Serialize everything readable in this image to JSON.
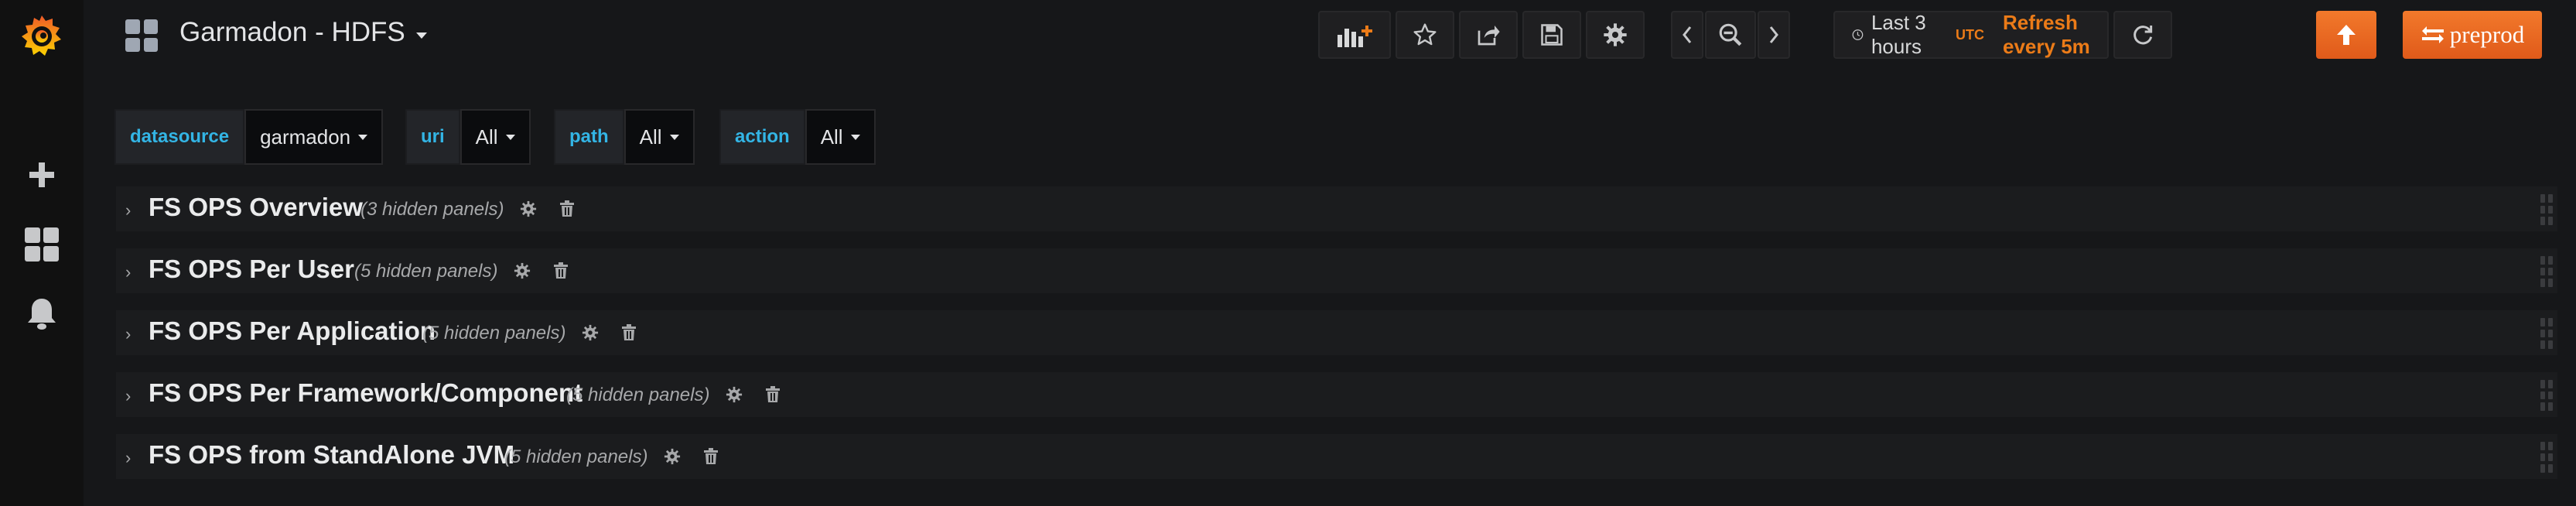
{
  "dashboard": {
    "title": "Garmadon - HDFS"
  },
  "toolbar": {
    "add_panel": "add-panel-icon",
    "star": "star-icon",
    "share": "share-icon",
    "save": "save-icon",
    "settings": "gear-icon",
    "time_back": "chevron-left-icon",
    "zoom_out": "zoom-out-icon",
    "time_forward": "chevron-right-icon",
    "time_range": "Last 3 hours",
    "timezone": "UTC",
    "refresh_interval": "Refresh every 5m",
    "refresh": "refresh-icon",
    "upload": "arrow-up-icon",
    "env_link": "preprod"
  },
  "sidebar": {
    "logo": "grafana-logo",
    "items": [
      {
        "icon": "plus-icon"
      },
      {
        "icon": "dashboards-icon"
      },
      {
        "icon": "bell-icon"
      }
    ]
  },
  "variables": [
    {
      "label": "datasource",
      "value": "garmadon"
    },
    {
      "label": "uri",
      "value": "All"
    },
    {
      "label": "path",
      "value": "All"
    },
    {
      "label": "action",
      "value": "All"
    }
  ],
  "rows": [
    {
      "title": "FS OPS Overview",
      "hidden": "(3 hidden panels)"
    },
    {
      "title": "FS OPS Per User",
      "hidden": "(5 hidden panels)"
    },
    {
      "title": "FS OPS Per Application",
      "hidden": "(5 hidden panels)"
    },
    {
      "title": "FS OPS Per Framework/Component",
      "hidden": "(5 hidden panels)"
    },
    {
      "title": "FS OPS from StandAlone JVM",
      "hidden": "(5 hidden panels)"
    }
  ],
  "colors": {
    "accent": "#eb7b18",
    "variable_label": "#33b5e5",
    "background": "#161719"
  }
}
